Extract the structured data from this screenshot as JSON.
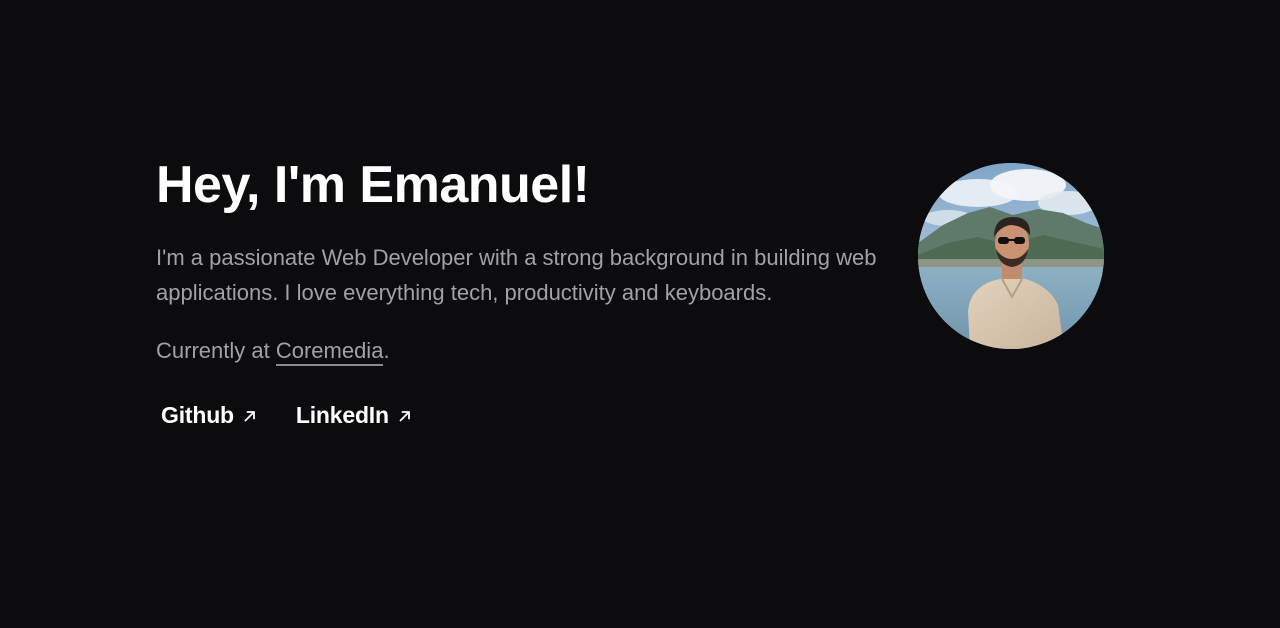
{
  "hero": {
    "title": "Hey, I'm Emanuel!",
    "bio": "I'm a passionate Web Developer with a strong background in building web applications. I love everything tech, productivity and keyboards.",
    "current_prefix": "Currently at ",
    "company": "Coremedia",
    "current_suffix": "."
  },
  "links": [
    {
      "label": "Github",
      "icon": "arrow-up-right-icon"
    },
    {
      "label": "LinkedIn",
      "icon": "arrow-up-right-icon"
    }
  ],
  "avatar": {
    "icon": "profile-photo"
  },
  "colors": {
    "background": "#0c0c0e",
    "heading": "#ffffff",
    "body_text": "#a1a1a6"
  }
}
